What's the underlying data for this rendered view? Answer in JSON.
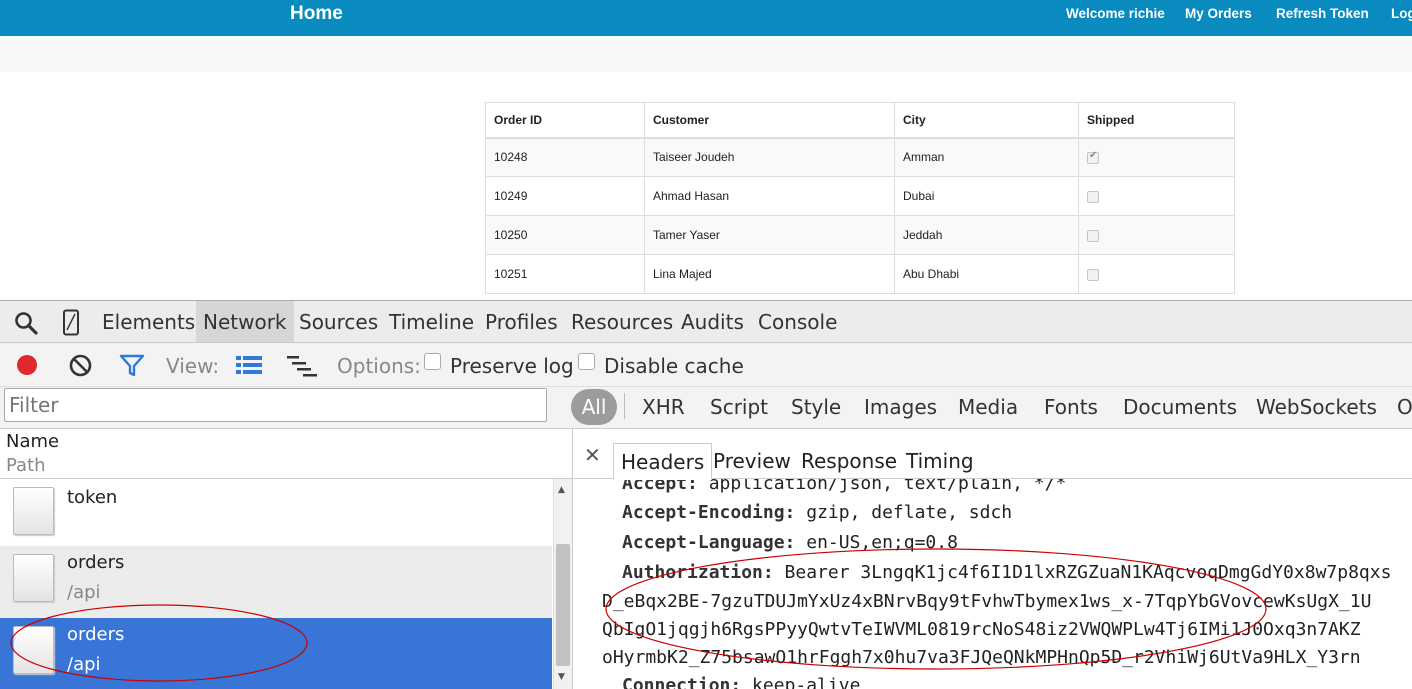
{
  "navbar": {
    "brand": "Home",
    "links": [
      "Welcome richie",
      "My Orders",
      "Refresh Token",
      "Log"
    ]
  },
  "orders_table": {
    "columns": [
      "Order ID",
      "Customer",
      "City",
      "Shipped"
    ],
    "rows": [
      {
        "id": "10248",
        "customer": "Taiseer Joudeh",
        "city": "Amman",
        "shipped": true
      },
      {
        "id": "10249",
        "customer": "Ahmad Hasan",
        "city": "Dubai",
        "shipped": false
      },
      {
        "id": "10250",
        "customer": "Tamer Yaser",
        "city": "Jeddah",
        "shipped": false
      },
      {
        "id": "10251",
        "customer": "Lina Majed",
        "city": "Abu Dhabi",
        "shipped": false
      }
    ]
  },
  "devtools": {
    "tabs": [
      "Elements",
      "Network",
      "Sources",
      "Timeline",
      "Profiles",
      "Resources",
      "Audits",
      "Console"
    ],
    "active_tab": "Network",
    "toolbar": {
      "view_label": "View:",
      "options_label": "Options:",
      "preserve_log": "Preserve log",
      "disable_cache": "Disable cache"
    },
    "filter": {
      "placeholder": "Filter",
      "types": [
        "All",
        "XHR",
        "Script",
        "Style",
        "Images",
        "Media",
        "Fonts",
        "Documents",
        "WebSockets",
        "O"
      ]
    },
    "requests_header": {
      "name": "Name",
      "path": "Path"
    },
    "requests": [
      {
        "name": "token",
        "path": ""
      },
      {
        "name": "orders",
        "path": "/api"
      },
      {
        "name": "orders",
        "path": "/api"
      }
    ],
    "detail_tabs": [
      "Headers",
      "Preview",
      "Response",
      "Timing"
    ],
    "headers": [
      {
        "key": "Accept:",
        "value": " application/json, text/plain, */*"
      },
      {
        "key": "Accept-Encoding:",
        "value": " gzip, deflate, sdch"
      },
      {
        "key": "Accept-Language:",
        "value": " en-US,en;q=0.8"
      },
      {
        "key": "Authorization:",
        "value": " Bearer 3LngqK1jc4f6I1D1lxRZGZuaN1KAqcvoqDmgGdY0x8w7p8qxs"
      },
      {
        "key": "Connection:",
        "value": " keep-alive"
      }
    ],
    "token_continuation": [
      "D_eBqx2BE-7gzuTDUJmYxUz4xBNrvBqy9tFvhwTbymex1ws_x-7TqpYbGVovcewKsUgX_1U",
      "QbIgO1jqgjh6RgsPPyyQwtvTeIWVML0819rcNoS48iz2VWQWPLw4Tj6IMi1J0Oxq3n7AKZ",
      "oHyrmbK2_Z75bsawO1hrFggh7x0hu7va3FJQeQNkMPHnQp5D_r2VhiWj6UtVa9HLX_Y3rn"
    ]
  },
  "colors": {
    "navbar": "#0a8bbf",
    "selected_row": "#3875d7",
    "record": "#e0282e",
    "annotation": "#cc0000"
  }
}
